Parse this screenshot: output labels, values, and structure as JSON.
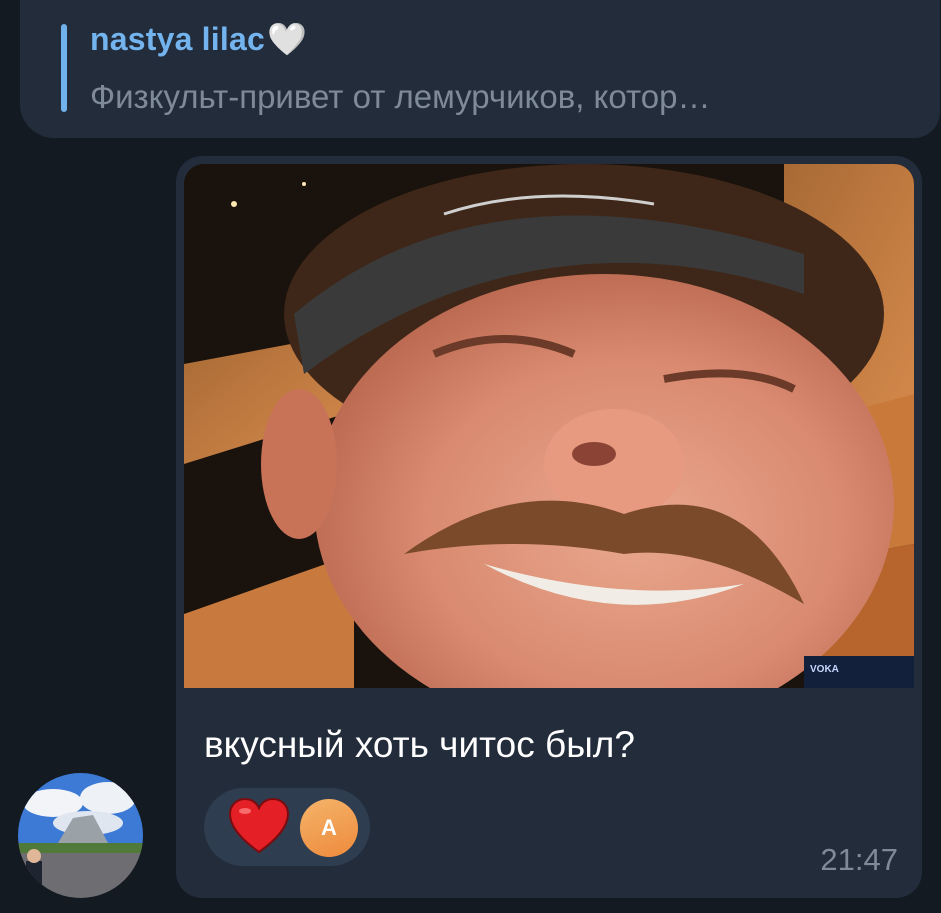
{
  "reply": {
    "author": "nastya lilac",
    "author_emoji": "🤍",
    "text": "Физкульт-привет от лемурчиков, котор…"
  },
  "message": {
    "caption": "вкусный хоть читос был?",
    "time": "21:47",
    "reaction": {
      "emoji": "heart",
      "reactor_initial": "A"
    }
  },
  "photo": {
    "watermark": "VOKA"
  },
  "colors": {
    "background": "#141a22",
    "bubble": "#222c3a",
    "accent": "#74b4ee",
    "secondary_text": "#7f8a97",
    "reaction_pill": "#2f3d50"
  }
}
